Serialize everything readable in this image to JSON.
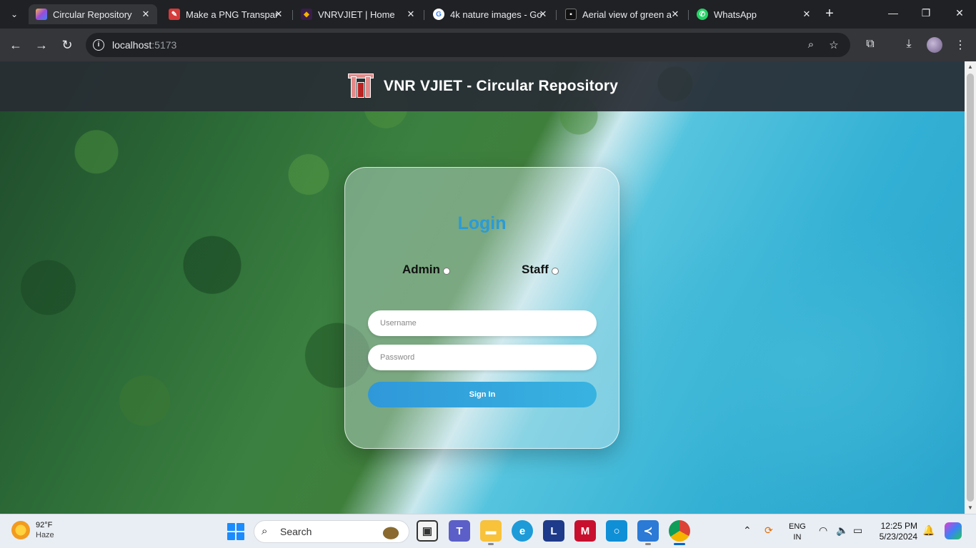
{
  "browser": {
    "tabs": [
      {
        "title": "Circular Repository",
        "active": true
      },
      {
        "title": "Make a PNG Transpar",
        "active": false
      },
      {
        "title": "VNRVJIET | Home",
        "active": false
      },
      {
        "title": "4k nature images - Go",
        "active": false
      },
      {
        "title": "Aerial view of green a",
        "active": false
      },
      {
        "title": "WhatsApp",
        "active": false
      }
    ],
    "url_host": "localhost",
    "url_port": ":5173"
  },
  "page": {
    "site_title": "VNR VJIET - Circular Repository",
    "login_title": "Login",
    "roles": [
      "Admin",
      "Staff"
    ],
    "username_placeholder": "Username",
    "password_placeholder": "Password",
    "signin_label": "Sign In"
  },
  "taskbar": {
    "weather_temp": "92°F",
    "weather_cond": "Haze",
    "search_label": "Search",
    "lang_line1": "ENG",
    "lang_line2": "IN",
    "time": "12:25 PM",
    "date": "5/23/2024"
  },
  "colors": {
    "accent": "#2b9bd6",
    "header_bg": "#282c34"
  }
}
